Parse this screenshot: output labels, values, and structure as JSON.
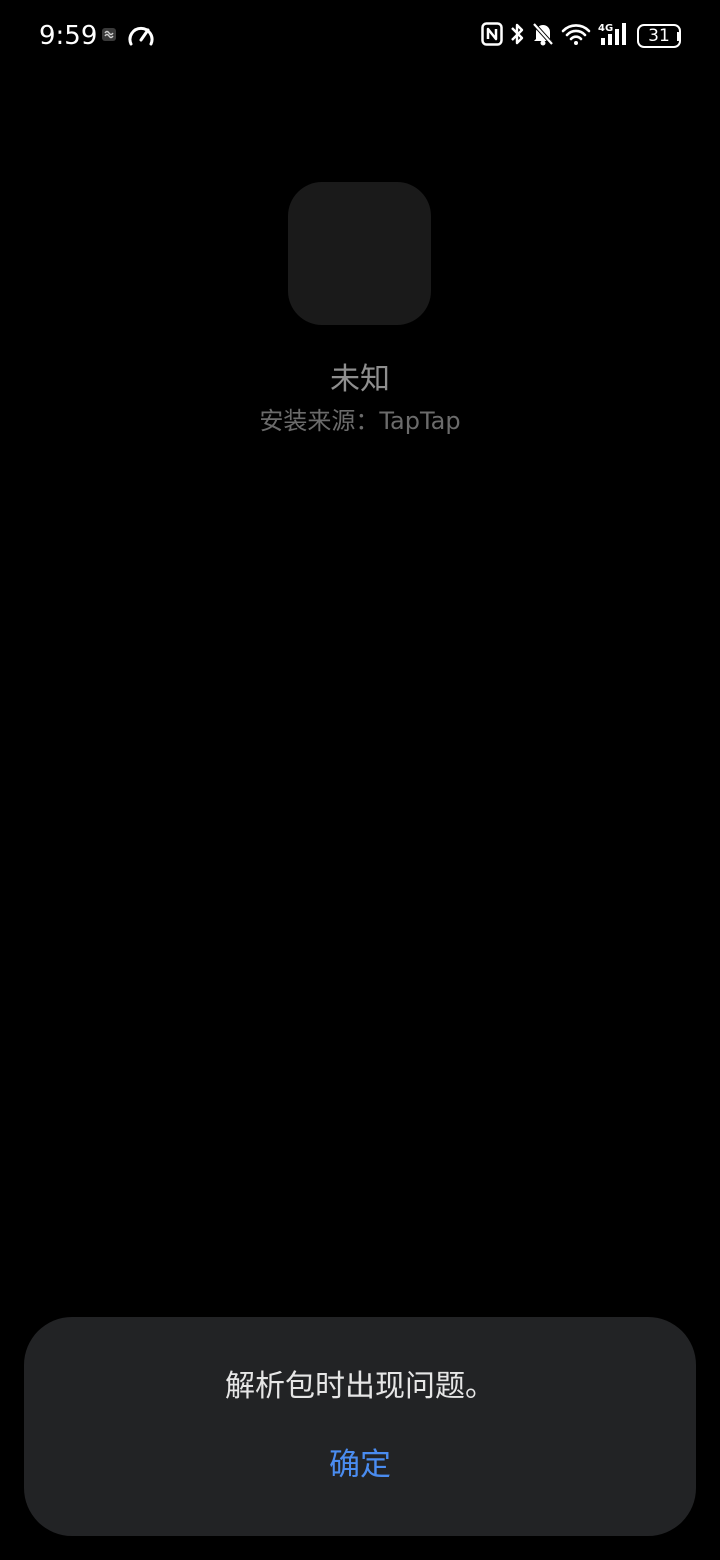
{
  "status_bar": {
    "time": "9:59",
    "battery_level": "31",
    "network_type": "4G",
    "icons": [
      "ai-assistant-icon",
      "speedometer-icon",
      "nfc-icon",
      "bluetooth-icon",
      "bell-muted-icon",
      "wifi-icon",
      "cellular-signal-icon",
      "battery-icon"
    ]
  },
  "app": {
    "name": "未知",
    "install_source": "安装来源：TapTap"
  },
  "dialog": {
    "message": "解析包时出现问题。",
    "confirm_label": "确定",
    "confirm_color": "#4a8cf0"
  },
  "colors": {
    "background": "#000000",
    "dialog_background": "#222325",
    "icon_placeholder": "#1a1a1a"
  }
}
